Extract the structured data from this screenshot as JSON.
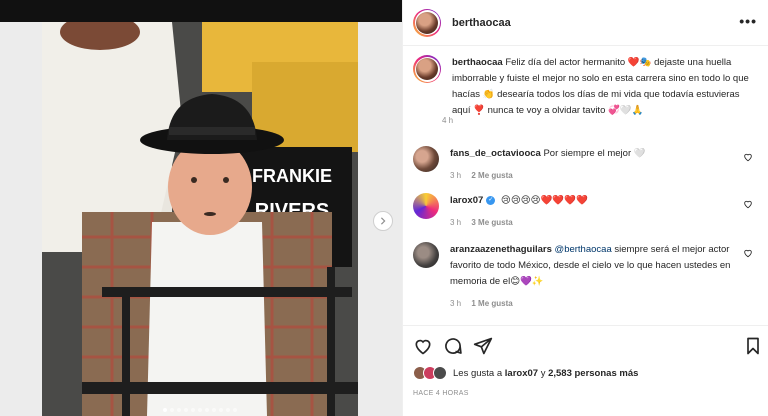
{
  "post": {
    "username": "berthaocaa",
    "caption_text": "Feliz día del actor hermanito ❤️🎭 dejaste una huella imborrable y fuiste el mejor no solo en esta carrera sino en todo lo que hacías 👏 desearía todos los días de mi vida que todavía estuvieras aquí ❣️ nunca te voy a olvidar tavito 💞🤍🙏",
    "caption_time": "4 h",
    "sign_text": "FRANKIE RIVERS",
    "carousel_slides": 11,
    "carousel_active_index": 0
  },
  "comments": [
    {
      "username": "fans_de_octaviooca",
      "text": "Por siempre el mejor 🤍",
      "time": "3 h",
      "likes": "2 Me gusta",
      "verified": false
    },
    {
      "username": "larox07",
      "text": "😢😢😢😢❤️❤️❤️❤️",
      "time": "3 h",
      "likes": "3 Me gusta",
      "verified": true
    },
    {
      "username": "aranzaazenethaguilars",
      "mention": "@berthaocaa",
      "text": "siempre será el mejor actor favorito de todo México, desde el cielo ve lo que hacen ustedes en memoria de el😊💜✨",
      "time": "3 h",
      "likes": "1 Me gusta",
      "verified": false
    }
  ],
  "likes": {
    "prefix": "Les gusta a",
    "user": "larox07",
    "joiner": "y",
    "others": "2,583 personas más"
  },
  "post_timestamp": "HACE 4 HORAS",
  "icons": {
    "more": "more-options-icon",
    "like": "heart-icon",
    "comment": "comment-icon",
    "share": "send-icon",
    "save": "bookmark-icon",
    "next": "chevron-right-icon"
  },
  "colors": {
    "text": "#262626",
    "muted": "#8e8e8e",
    "verified": "#3897f0",
    "border": "#efefef"
  }
}
